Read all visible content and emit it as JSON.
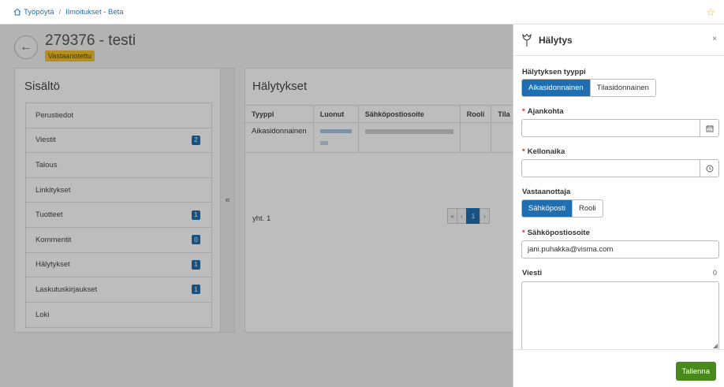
{
  "breadcrumb": {
    "home": "Työpöytä",
    "separator": "/",
    "current": "Ilmoitukset - Beta"
  },
  "header": {
    "title": "279376 - testi",
    "status": "Vastaanotettu"
  },
  "sidebar": {
    "title": "Sisältö",
    "items": [
      {
        "label": "Perustiedot",
        "count": ""
      },
      {
        "label": "Viestit",
        "count": "2"
      },
      {
        "label": "Talous",
        "count": ""
      },
      {
        "label": "Linkitykset",
        "count": ""
      },
      {
        "label": "Tuotteet",
        "count": "1"
      },
      {
        "label": "Kommentit",
        "count": "0"
      },
      {
        "label": "Hälytykset",
        "count": "1"
      },
      {
        "label": "Laskutuskirjaukset",
        "count": "1"
      },
      {
        "label": "Loki",
        "count": ""
      }
    ],
    "collapse_glyph": "«"
  },
  "alerts": {
    "title": "Hälytykset",
    "columns": [
      "Tyyppi",
      "Luonut",
      "Sähköpostiosoite",
      "Rooli",
      "Tila"
    ],
    "rows": [
      {
        "tyyppi": "Aikasidonnainen"
      }
    ],
    "total": "yht. 1",
    "pager": {
      "first": "«",
      "prev": "‹",
      "page": "1",
      "next": "›"
    }
  },
  "panel": {
    "title": "Hälytys",
    "close_glyph": "×",
    "type_label": "Hälytyksen tyyppi",
    "type_options": [
      "Aikasidonnainen",
      "Tilasidonnainen"
    ],
    "time_point_label": "Ajankohta",
    "time_point_value": "",
    "clock_label": "Kellonaika",
    "clock_value": "",
    "recipient_label": "Vastaanottaja",
    "recipient_options": [
      "Sähköposti",
      "Rooli"
    ],
    "email_label": "Sähköpostiosoite",
    "email_value": "jani.puhakka@visma.com",
    "message_label": "Viesti",
    "message_counter": "0",
    "required_mark": "*",
    "save_label": "Tallenna"
  },
  "colors": {
    "accent": "#1f6fb0",
    "save": "#4a8a1a",
    "status_badge": "#f3c230",
    "required": "#d0312d",
    "star": "#f2b632"
  },
  "icons": {
    "home": "home-icon",
    "star": "star-icon",
    "back": "arrow-left-icon",
    "panel": "tulip-icon",
    "calendar": "calendar-icon",
    "clock": "clock-icon"
  }
}
